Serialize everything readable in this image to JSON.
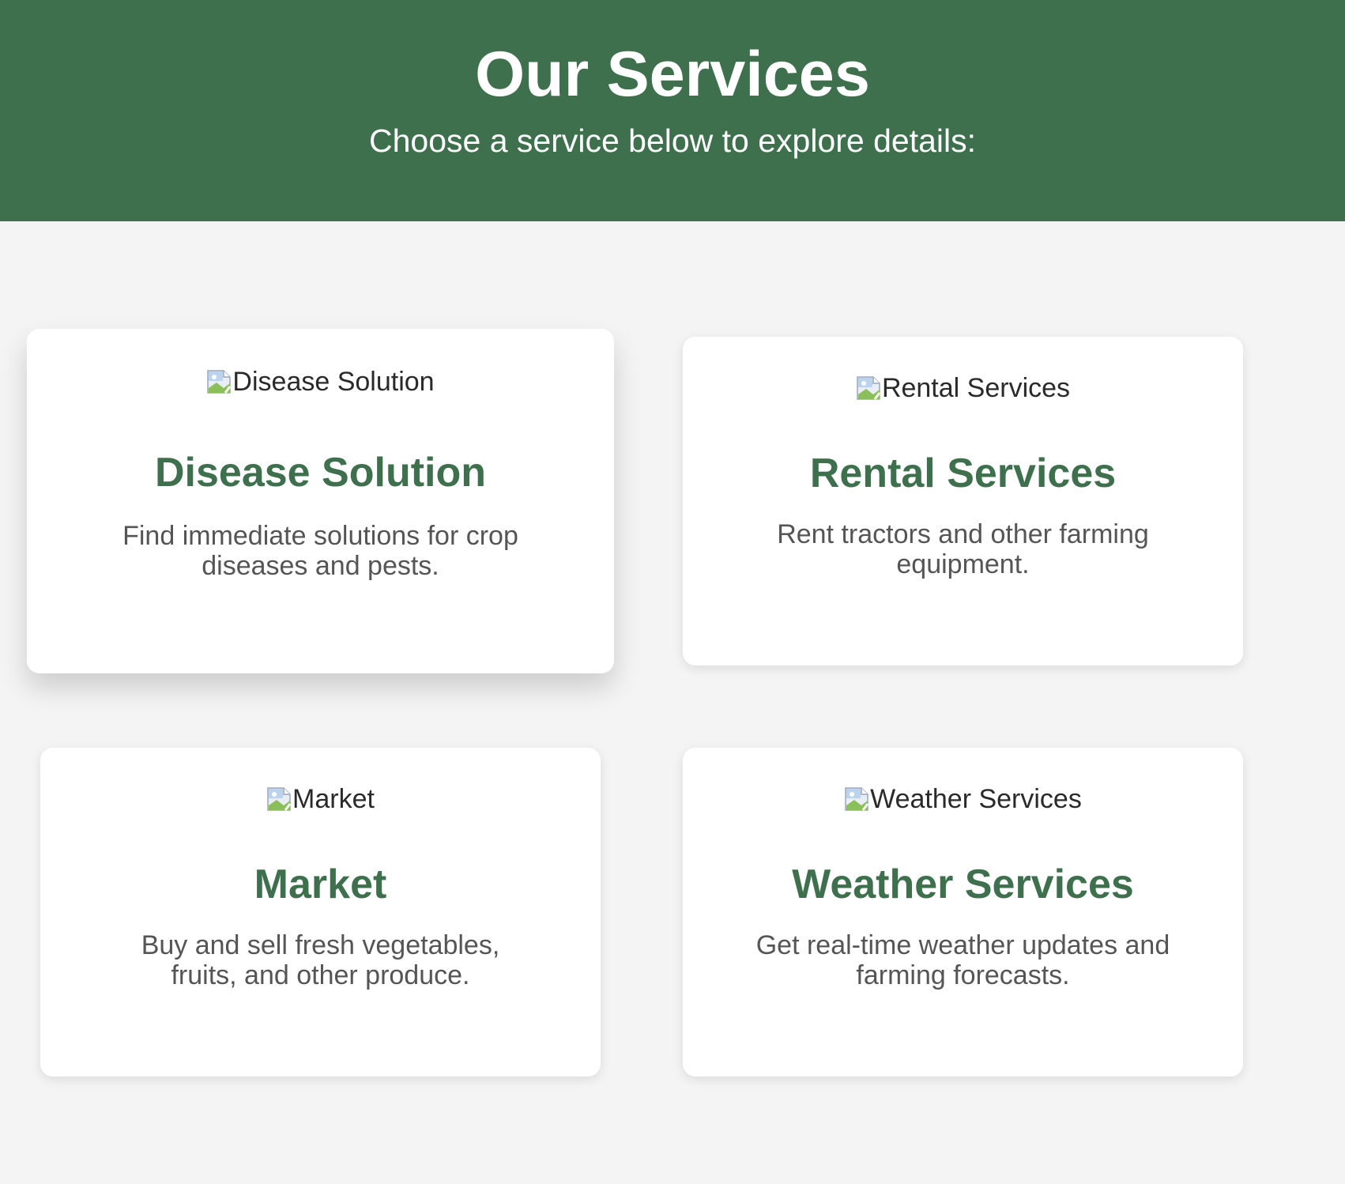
{
  "header": {
    "title": "Our Services",
    "subtitle": "Choose a service below to explore details:"
  },
  "services": [
    {
      "image_alt": "Disease Solution",
      "title": "Disease Solution",
      "description": "Find immediate solutions for crop diseases and pests."
    },
    {
      "image_alt": "Rental Services",
      "title": "Rental Services",
      "description": "Rent tractors and other farming equipment."
    },
    {
      "image_alt": "Market",
      "title": "Market",
      "description": "Buy and sell fresh vegetables, fruits, and other produce."
    },
    {
      "image_alt": "Weather Services",
      "title": "Weather Services",
      "description": "Get real-time weather updates and farming forecasts."
    }
  ],
  "colors": {
    "header_bg": "#3f704d",
    "accent": "#3f704d",
    "page_bg": "#f4f4f4",
    "card_bg": "#ffffff",
    "body_text": "#555555"
  },
  "icons": {
    "service_image": "broken-image-icon"
  }
}
